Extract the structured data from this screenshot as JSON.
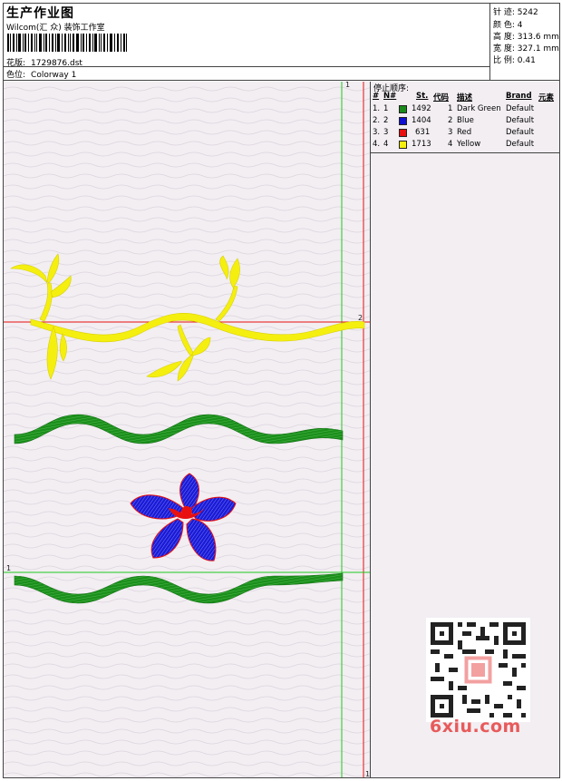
{
  "header": {
    "title": "生产作业图",
    "studio": "Wilcom(汇 众) 装饰工作室",
    "design_label": "花版:",
    "design_value": "1729876.dst",
    "colorway_label": "色位:",
    "colorway_value": "Colorway 1"
  },
  "stats": [
    {
      "label": "针 迹:",
      "value": "5242"
    },
    {
      "label": "颜 色:",
      "value": "4"
    },
    {
      "label": "高 度:",
      "value": "313.6 mm"
    },
    {
      "label": "宽 度:",
      "value": "327.1 mm"
    },
    {
      "label": "比 例:",
      "value": "0.41"
    }
  ],
  "stop_sequence": {
    "heading": "停止顺序:",
    "columns": [
      "#",
      "N#",
      "St.",
      "代码",
      "描述",
      "Brand",
      "元素"
    ],
    "rows": [
      {
        "idx": "1.",
        "n": "1",
        "color": "#1a8a1a",
        "st": "1492",
        "code": "1",
        "desc": "Dark Green",
        "brand": "Default"
      },
      {
        "idx": "2.",
        "n": "2",
        "color": "#1010d0",
        "st": "1404",
        "code": "2",
        "desc": "Blue",
        "brand": "Default"
      },
      {
        "idx": "3.",
        "n": "3",
        "color": "#e81010",
        "st": "631",
        "code": "3",
        "desc": "Red",
        "brand": "Default"
      },
      {
        "idx": "4.",
        "n": "4",
        "color": "#f5ef10",
        "st": "1713",
        "code": "4",
        "desc": "Yellow",
        "brand": "Default"
      }
    ]
  },
  "guides": {
    "v1": "1",
    "h2": "2",
    "h1": "1",
    "v2": "1"
  },
  "watermark": {
    "logo": "6xiu.com"
  },
  "colors": {
    "green_guide": "#1ec81e",
    "red_guide": "#e81010",
    "canvas": "#f2eef2"
  }
}
